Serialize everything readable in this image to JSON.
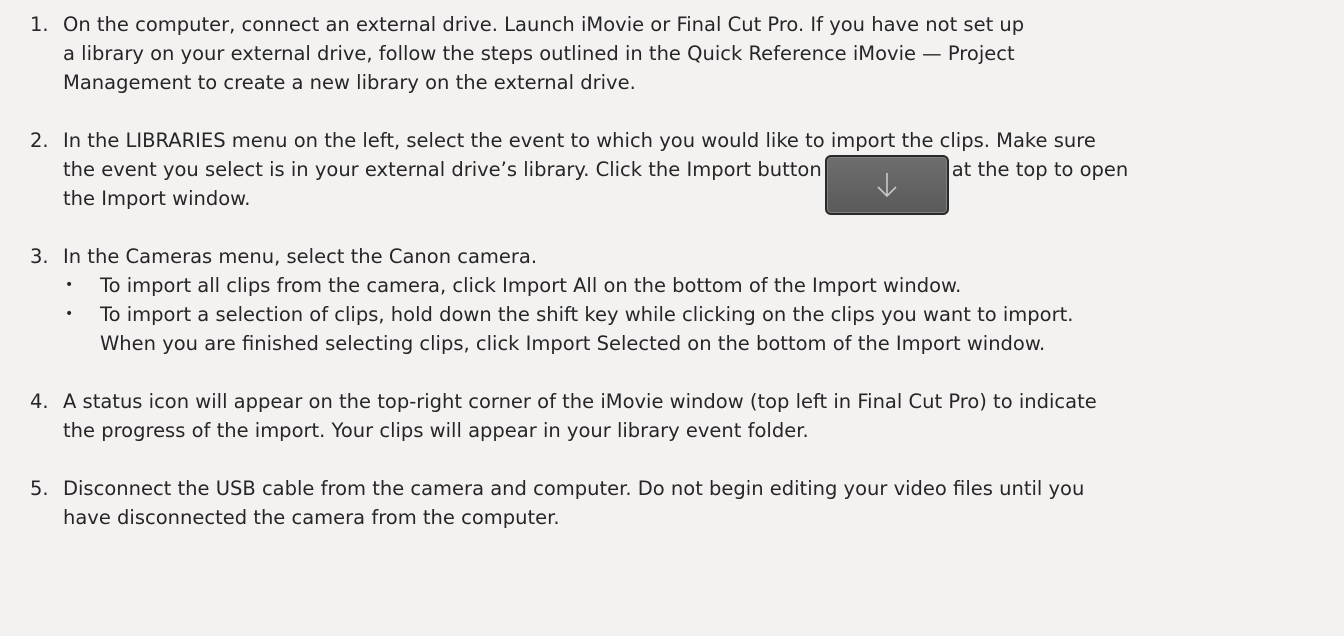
{
  "steps": [
    {
      "number": "1.",
      "lines": [
        "On the computer, connect an external drive. Launch iMovie or Final Cut Pro. If you have not set up",
        "a library on your external drive, follow the steps outlined in the Quick Reference iMovie — Project",
        "Management to create a new library on the external drive."
      ]
    },
    {
      "number": "2.",
      "line1": "In the LIBRARIES menu on the left, select the event to which you would like to import the clips. Make sure",
      "line2_before": "the event you select is in your external drive’s library. Click the Import button",
      "line2_after": "at the top to open",
      "line3": "the Import window."
    },
    {
      "number": "3.",
      "line1": "In the Cameras menu, select the Canon camera.",
      "bullets": [
        {
          "lines": [
            "To import all clips from the camera, click Import All on the bottom of the Import window."
          ]
        },
        {
          "lines": [
            "To import a selection of clips, hold down the shift key while clicking on the clips you want to import.",
            "When you are finished selecting clips, click Import Selected on the bottom of the Import window."
          ]
        }
      ]
    },
    {
      "number": "4.",
      "lines": [
        "A status icon will appear on the top-right corner of the iMovie window (top left in Final Cut Pro) to indicate",
        "the progress of the import. Your clips will appear in your library event folder."
      ]
    },
    {
      "number": "5.",
      "lines": [
        "Disconnect the USB cable from the camera and computer. Do not begin editing your video files until you",
        "have disconnected the camera from the computer."
      ]
    }
  ],
  "bullet_glyph": "•",
  "import_button": {
    "icon": "down-arrow-icon",
    "color": "#5f5f5f"
  }
}
